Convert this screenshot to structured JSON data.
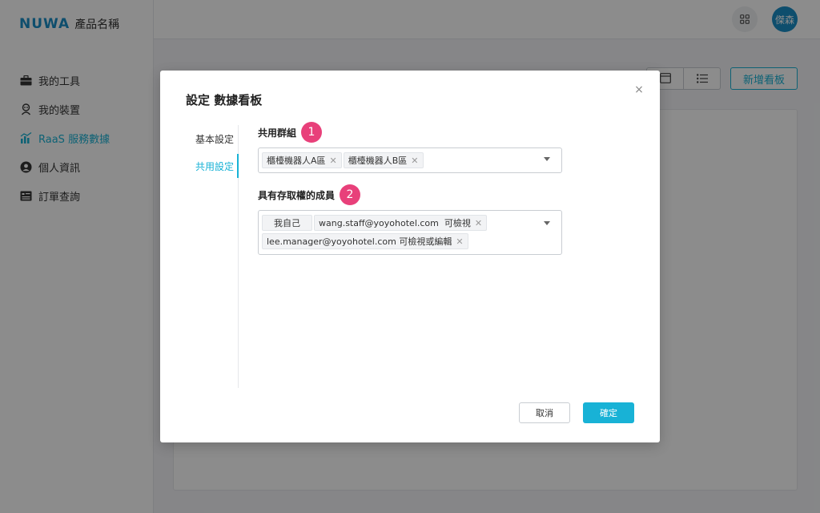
{
  "app": {
    "logo_mark": "NUWA",
    "product_name": "產品名稱"
  },
  "sidebar": {
    "items": [
      {
        "label": "我的工具",
        "icon": "toolbox-icon",
        "active": false
      },
      {
        "label": "我的裝置",
        "icon": "robot-icon",
        "active": false
      },
      {
        "label": "RaaS 服務數據",
        "icon": "chart-icon",
        "active": true
      },
      {
        "label": "個人資訊",
        "icon": "user-icon",
        "active": false
      },
      {
        "label": "訂單查詢",
        "icon": "order-icon",
        "active": false
      }
    ]
  },
  "topbar": {
    "apps_icon": "grid-icon",
    "avatar_text": "傑森"
  },
  "main": {
    "add_board_label": "新增看板",
    "view_icons": [
      "card-view-icon",
      "list-view-icon"
    ]
  },
  "modal": {
    "title": "設定 數據看板",
    "close_label": "×",
    "tabs": [
      {
        "label": "基本設定",
        "active": false
      },
      {
        "label": "共用設定",
        "active": true
      }
    ],
    "group_field": {
      "label": "共用群組",
      "badge": "1",
      "tags": [
        {
          "text": "櫃檯機器人A區"
        },
        {
          "text": "櫃檯機器人B區"
        }
      ]
    },
    "member_field": {
      "label": "具有存取權的成員",
      "badge": "2",
      "self_tag": "我自己",
      "tags": [
        {
          "text": "wang.staff@yoyohotel.com  可檢視"
        },
        {
          "text": "lee.manager@yoyohotel.com 可檢視或編輯"
        }
      ]
    },
    "cancel_label": "取消",
    "ok_label": "確定"
  },
  "colors": {
    "accent": "#18b2d6",
    "badge": "#e8407a",
    "brand": "#1a8fc7"
  }
}
